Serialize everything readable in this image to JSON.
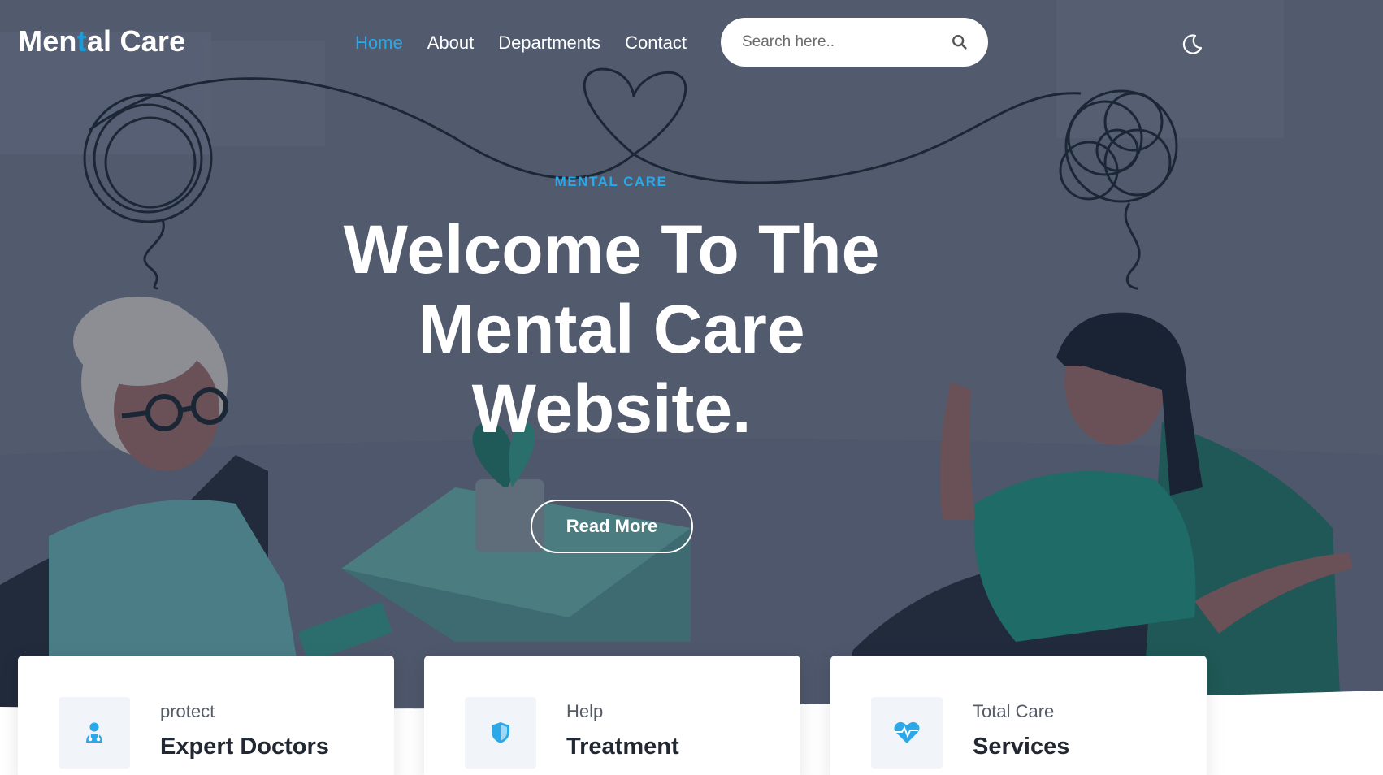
{
  "brand": {
    "part1": "Men",
    "accent": "t",
    "part2": "al Care"
  },
  "nav": {
    "items": [
      {
        "label": "Home",
        "active": true
      },
      {
        "label": "About"
      },
      {
        "label": "Departments"
      },
      {
        "label": "Contact"
      }
    ]
  },
  "search": {
    "placeholder": "Search here..",
    "icon": "search-icon"
  },
  "theme_toggle": {
    "icon": "moon-icon"
  },
  "hero": {
    "eyebrow": "MENTAL CARE",
    "headline_line1": "Welcome To The",
    "headline_line2": "Mental Care",
    "headline_line3": "Website.",
    "cta": "Read More"
  },
  "features": [
    {
      "kicker": "protect",
      "title": "Expert Doctors",
      "icon": "doctor-icon"
    },
    {
      "kicker": "Help",
      "title": "Treatment",
      "icon": "shield-icon"
    },
    {
      "kicker": "Total Care",
      "title": "Services",
      "icon": "heartbeat-icon"
    }
  ],
  "colors": {
    "hero_bg": "#525b6e",
    "accent": "#1e9bd7",
    "card_bg": "#ffffff",
    "icon_box": "#f1f4f8"
  }
}
